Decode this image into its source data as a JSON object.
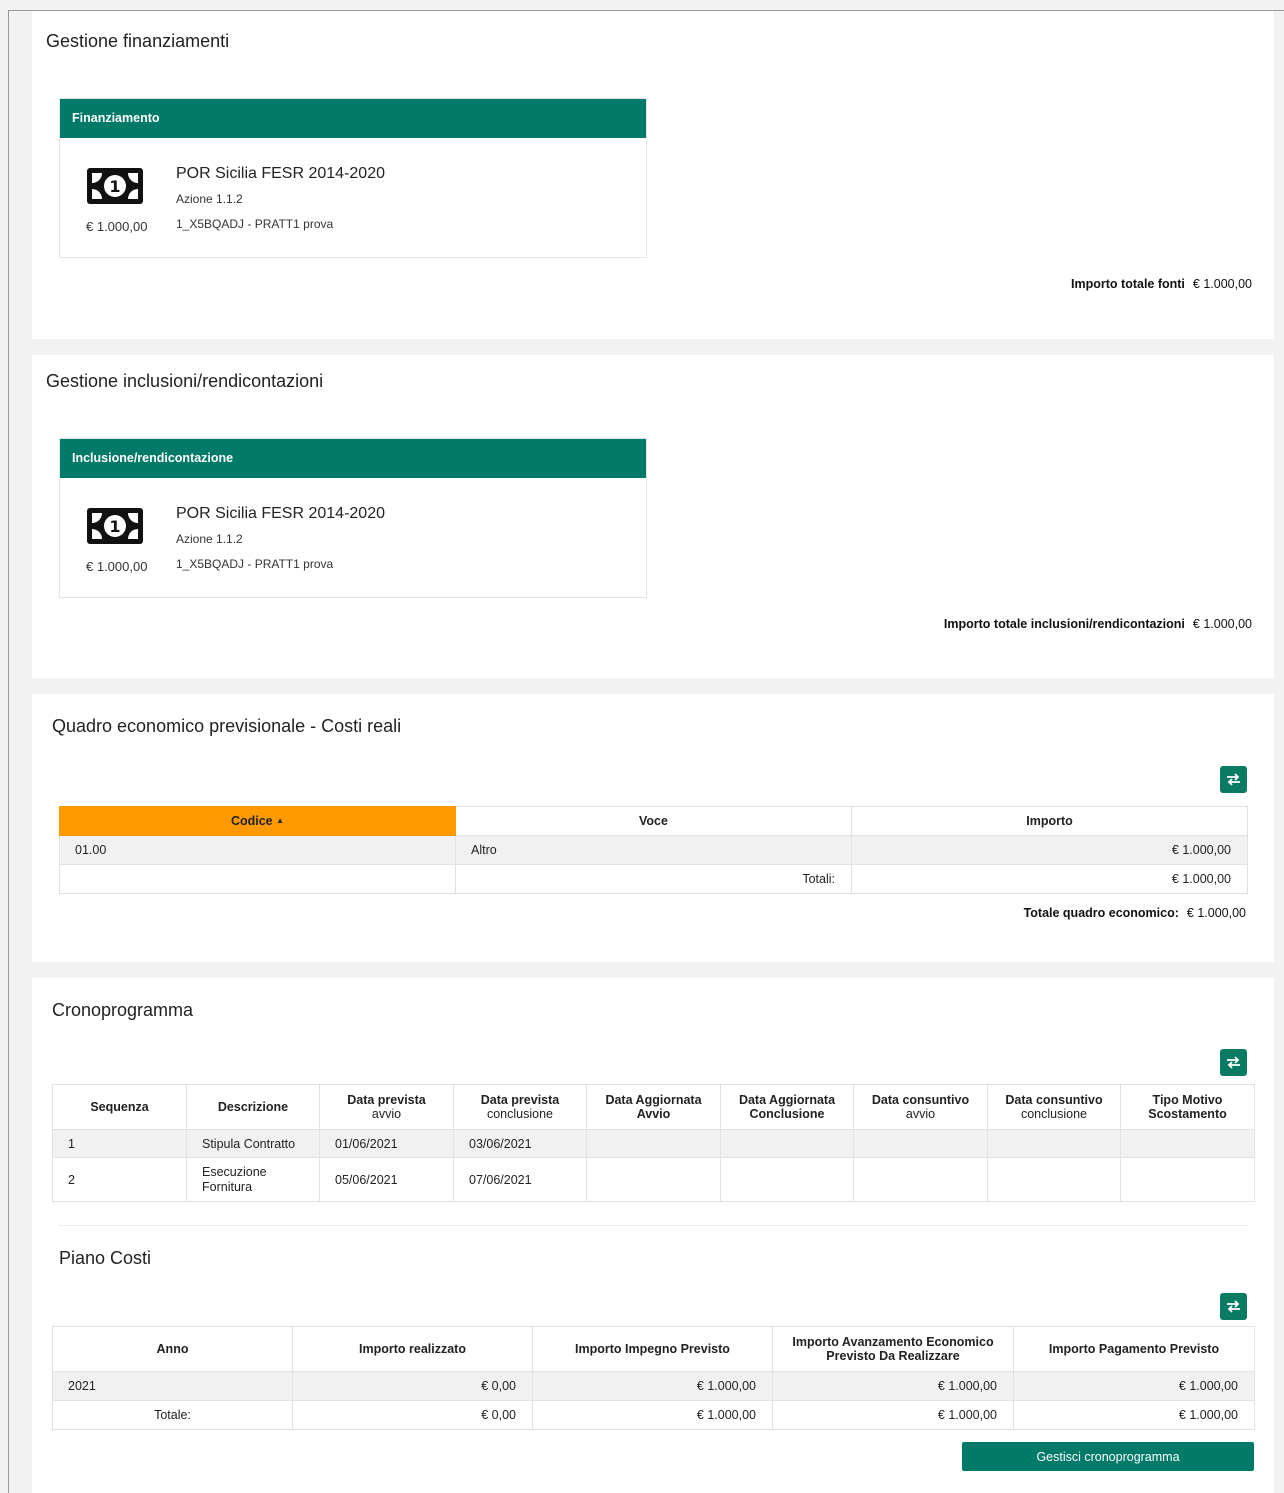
{
  "finanziamenti": {
    "title": "Gestione finanziamenti",
    "card_header": "Finanziamento",
    "card": {
      "amount": "€ 1.000,00",
      "title": "POR Sicilia FESR 2014-2020",
      "azione": "Azione 1.1.2",
      "codice": "1_X5BQADJ - PRATT1 prova",
      "icon": "money-icon"
    },
    "total_label": "Importo totale fonti",
    "total_value": "€ 1.000,00"
  },
  "inclusioni": {
    "title": "Gestione inclusioni/rendicontazioni",
    "card_header": "Inclusione/rendicontazione",
    "card": {
      "amount": "€ 1.000,00",
      "title": "POR Sicilia FESR 2014-2020",
      "azione": "Azione 1.1.2",
      "codice": "1_X5BQADJ - PRATT1 prova",
      "icon": "money-icon"
    },
    "total_label": "Importo totale inclusioni/rendicontazioni",
    "total_value": "€ 1.000,00"
  },
  "quadro": {
    "title": "Quadro economico previsionale - Costi reali",
    "headers": {
      "codice": "Codice",
      "voce": "Voce",
      "importo": "Importo"
    },
    "sort_indicator": "▲",
    "row": {
      "codice": "01.00",
      "voce": "Altro",
      "importo": "€ 1.000,00"
    },
    "totali_label": "Totali:",
    "totali_value": "€ 1.000,00",
    "totale_label": "Totale quadro economico:",
    "totale_value": "€ 1.000,00",
    "header_color": "#ff9900"
  },
  "crono": {
    "title": "Cronoprogramma",
    "headers": {
      "sequenza": "Sequenza",
      "descrizione": "Descrizione",
      "dpa_1": "Data prevista",
      "dpa_2": "avvio",
      "dpc_1": "Data prevista",
      "dpc_2": "conclusione",
      "daa_1": "Data Aggiornata",
      "daa_2": "Avvio",
      "dac_1": "Data Aggiornata",
      "dac_2": "Conclusione",
      "dca_1": "Data consuntivo",
      "dca_2": "avvio",
      "dcc_1": "Data consuntivo",
      "dcc_2": "conclusione",
      "tms_1": "Tipo Motivo",
      "tms_2": "Scostamento"
    },
    "rows": [
      {
        "seq": "1",
        "desc_1": "Stipula Contratto",
        "desc_2": "",
        "dpa": "01/06/2021",
        "dpc": "03/06/2021"
      },
      {
        "seq": "2",
        "desc_1": "Esecuzione",
        "desc_2": "Fornitura",
        "dpa": "05/06/2021",
        "dpc": "07/06/2021"
      }
    ]
  },
  "piano": {
    "title": "Piano Costi",
    "headers": {
      "anno": "Anno",
      "realizzato": "Importo realizzato",
      "impegno": "Importo Impegno Previsto",
      "avanz_1": "Importo Avanzamento Economico",
      "avanz_2": "Previsto Da Realizzare",
      "pagamento": "Importo Pagamento Previsto"
    },
    "row": {
      "anno": "2021",
      "realizzato": "€ 0,00",
      "impegno": "€ 1.000,00",
      "avanz": "€ 1.000,00",
      "pagamento": "€ 1.000,00"
    },
    "totale": {
      "label": "Totale:",
      "realizzato": "€ 0,00",
      "impegno": "€ 1.000,00",
      "avanz": "€ 1.000,00",
      "pagamento": "€ 1.000,00"
    },
    "button": "Gestisci cronoprogramma"
  },
  "colors": {
    "accent": "#007a68",
    "sort_header": "#ff9900"
  }
}
